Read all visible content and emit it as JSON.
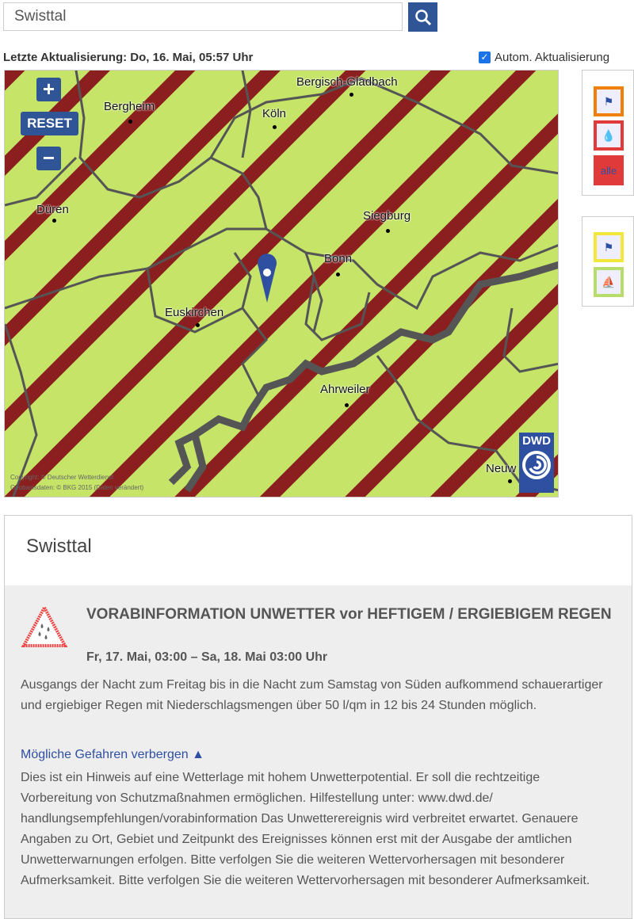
{
  "search": {
    "value": "Swisttal"
  },
  "status": {
    "last_update": "Letzte Aktualisierung: Do, 16. Mai, 05:57 Uhr",
    "auto_update_label": "Autom. Aktualisierung",
    "auto_update_checked": true
  },
  "map": {
    "zoom_in": "+",
    "reset": "RESET",
    "zoom_out": "−",
    "cities": [
      {
        "name": "Bergisch-Gladbach"
      },
      {
        "name": "Bergheim"
      },
      {
        "name": "Köln"
      },
      {
        "name": "Düren"
      },
      {
        "name": "Siegburg"
      },
      {
        "name": "Bonn"
      },
      {
        "name": "Euskirchen"
      },
      {
        "name": "Ahrweiler"
      },
      {
        "name": "Neuw"
      }
    ],
    "copyright1": "Copyright: © Deutscher Wetterdienst",
    "copyright2": "Geobasisdaten: © BKG 2015 (Daten verändert)",
    "logo": "DWD",
    "colors": {
      "land": "#c5e468",
      "stripe": "#8b1f1f",
      "border": "#555555"
    }
  },
  "layers": {
    "wind": "wind-icon",
    "rain": "rain-icon",
    "all": "alle",
    "coast": "coast-wind-icon",
    "sea": "sea-wind-icon"
  },
  "panel": {
    "location": "Swisttal",
    "warning_title": "VORABINFORMATION UNWETTER vor HEFTIGEM / ERGIEBIGEM REGEN",
    "warning_time": "Fr, 17. Mai, 03:00 – Sa, 18. Mai 03:00 Uhr",
    "description": "Ausgangs der Nacht zum Freitag bis in die Nacht zum Samstag von Süden aufkommend schauerartiger und ergiebiger Regen mit Niederschlagsmengen über 50 l/qm in 12 bis 24 Stunden möglich.",
    "toggle_label": "Mögliche Gefahren verbergen ▲",
    "details": "Dies ist ein Hinweis auf eine Wetterlage mit hohem Unwetterpotential. Er soll die rechtzeitige Vorbereitung von Schutzmaßnahmen ermöglichen. Hilfestellung unter: www.dwd.de/ handlungsempfehlungen/vorabinformation Das Unwetterereignis wird verbreitet erwartet. Genauere Angaben zu Ort, Gebiet und Zeitpunkt des Ereignisses können erst mit der Ausgabe der amtlichen Unwetterwarnungen erfolgen. Bitte verfolgen Sie die weiteren Wettervorhersagen mit besonderer Aufmerksamkeit. Bitte verfolgen Sie die weiteren Wettervorhersagen mit besonderer Aufmerksamkeit."
  }
}
